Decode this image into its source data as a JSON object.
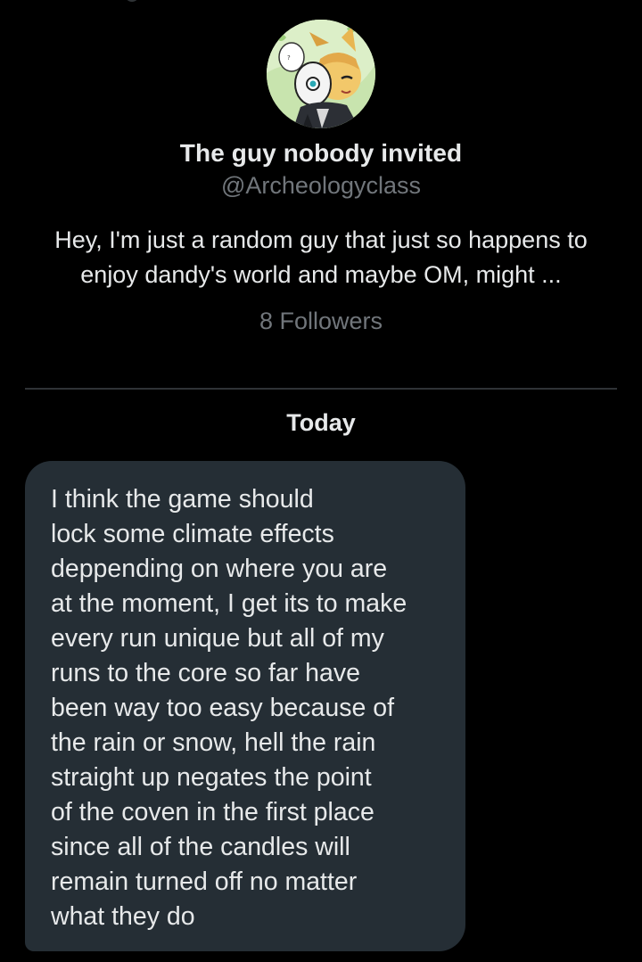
{
  "profile": {
    "display_name": "The guy nobody invited",
    "handle": "@Archeologyclass",
    "bio": "Hey, I'm just a random guy that just so happens to enjoy dandy's world and maybe OM, might ...",
    "followers": "8 Followers",
    "avatar_icon": "anime-character-avatar"
  },
  "conversation": {
    "date_separator": "Today",
    "messages": [
      {
        "text": "I think the game should\nlock some climate effects\ndeppending on where you are\nat the moment, I get its to make\nevery run unique but all of my\nruns to the core so far have\nbeen way too easy because of\nthe rain or snow, hell the rain\nstraight up negates the point\nof the coven in the first place\nsince all of the candles will\nremain turned off no matter\nwhat they do"
      }
    ]
  },
  "colors": {
    "background": "#000000",
    "primary_text": "#e7e9ea",
    "secondary_text": "#71767b",
    "bubble": "#252e35",
    "divider": "#2f3336"
  }
}
